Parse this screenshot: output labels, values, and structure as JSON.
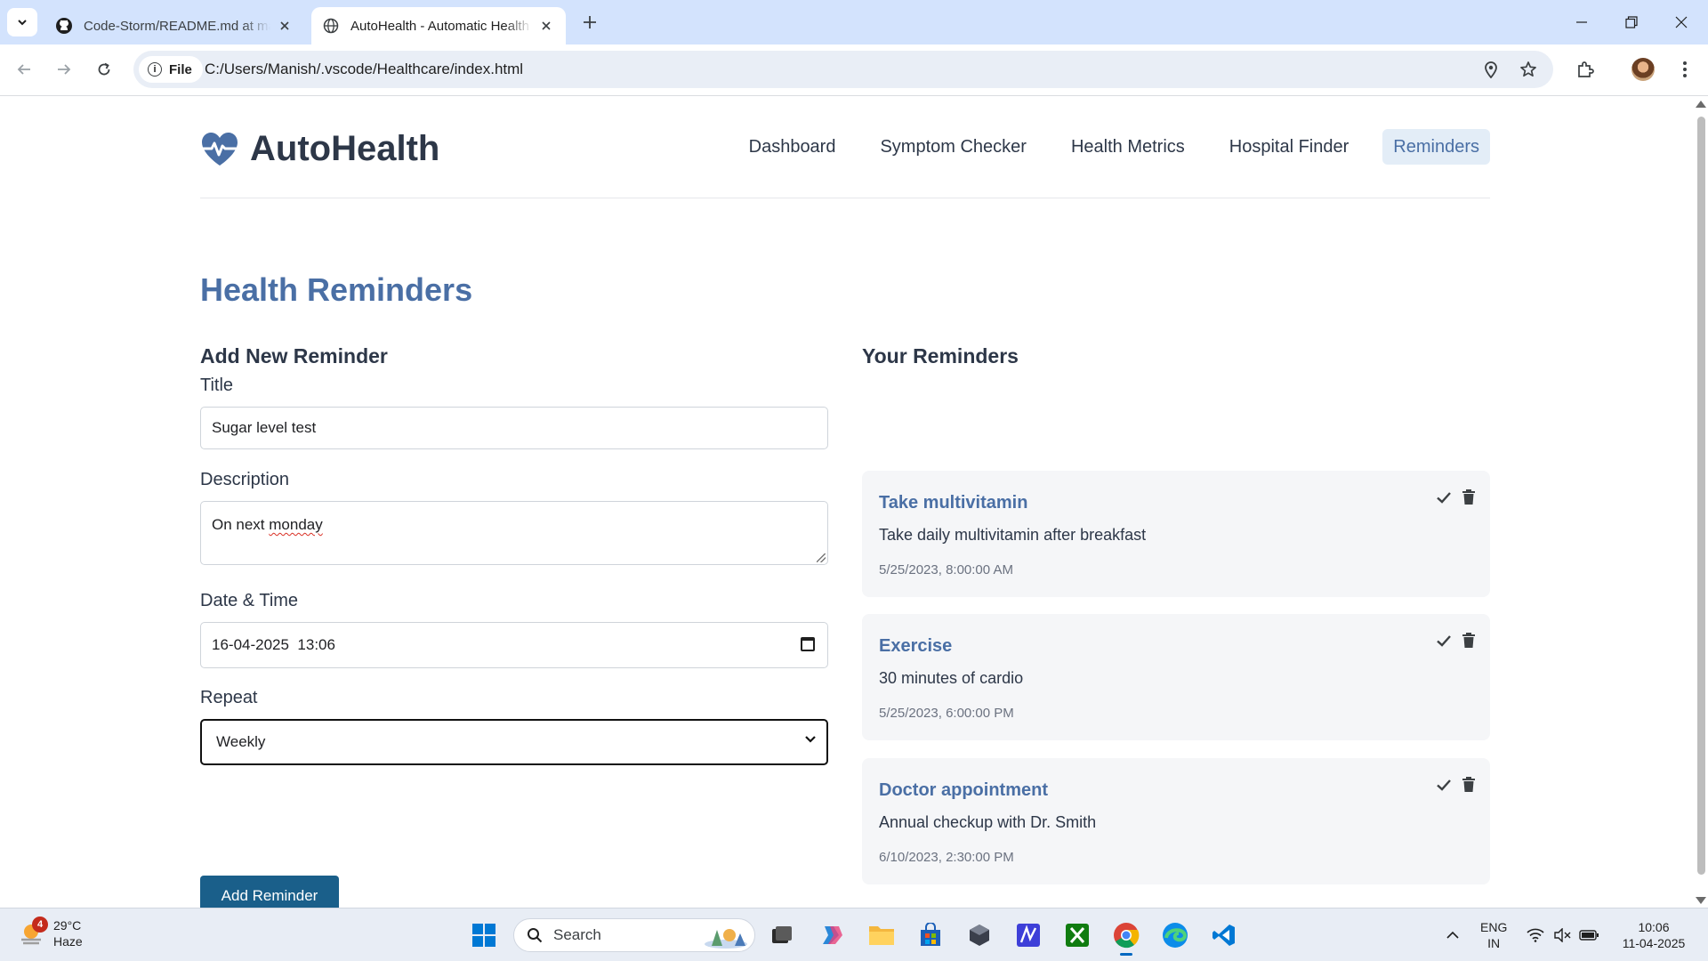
{
  "browser": {
    "tabs": [
      {
        "title": "Code-Storm/README.md at main",
        "active": false,
        "icon": "github-icon"
      },
      {
        "title": "AutoHealth - Automatic Health",
        "active": true,
        "icon": "globe-icon"
      }
    ],
    "site_chip": "File",
    "url": "C:/Users/Manish/.vscode/Healthcare/index.html"
  },
  "site": {
    "logo_text": "AutoHealth",
    "nav": [
      "Dashboard",
      "Symptom Checker",
      "Health Metrics",
      "Hospital Finder",
      "Reminders"
    ],
    "active_nav": "Reminders"
  },
  "page": {
    "title": "Health Reminders",
    "form": {
      "heading": "Add New Reminder",
      "title_label": "Title",
      "title_value": "Sugar level test",
      "desc_label": "Description",
      "desc_value_prefix": "On next ",
      "desc_value_misspelled": "monday",
      "datetime_label": "Date & Time",
      "datetime_value": "16-04-2025  13:06",
      "repeat_label": "Repeat",
      "repeat_value": "Weekly",
      "submit_label": "Add Reminder"
    },
    "list": {
      "heading": "Your Reminders",
      "items": [
        {
          "title": "Take multivitamin",
          "description": "Take daily multivitamin after breakfast",
          "datetime": "5/25/2023, 8:00:00 AM"
        },
        {
          "title": "Exercise",
          "description": "30 minutes of cardio",
          "datetime": "5/25/2023, 6:00:00 PM"
        },
        {
          "title": "Doctor appointment",
          "description": "Annual checkup with Dr. Smith",
          "datetime": "6/10/2023, 2:30:00 PM"
        }
      ]
    }
  },
  "taskbar": {
    "weather_temp": "29°C",
    "weather_cond": "Haze",
    "weather_badge": "4",
    "search_label": "Search",
    "lang_top": "ENG",
    "lang_bottom": "IN",
    "time": "10:06",
    "date": "11-04-2025"
  },
  "colors": {
    "accent": "#4a6fa5",
    "button": "#1a5f8a",
    "tabbar": "#d3e3fd",
    "card": "#f5f6f8"
  }
}
